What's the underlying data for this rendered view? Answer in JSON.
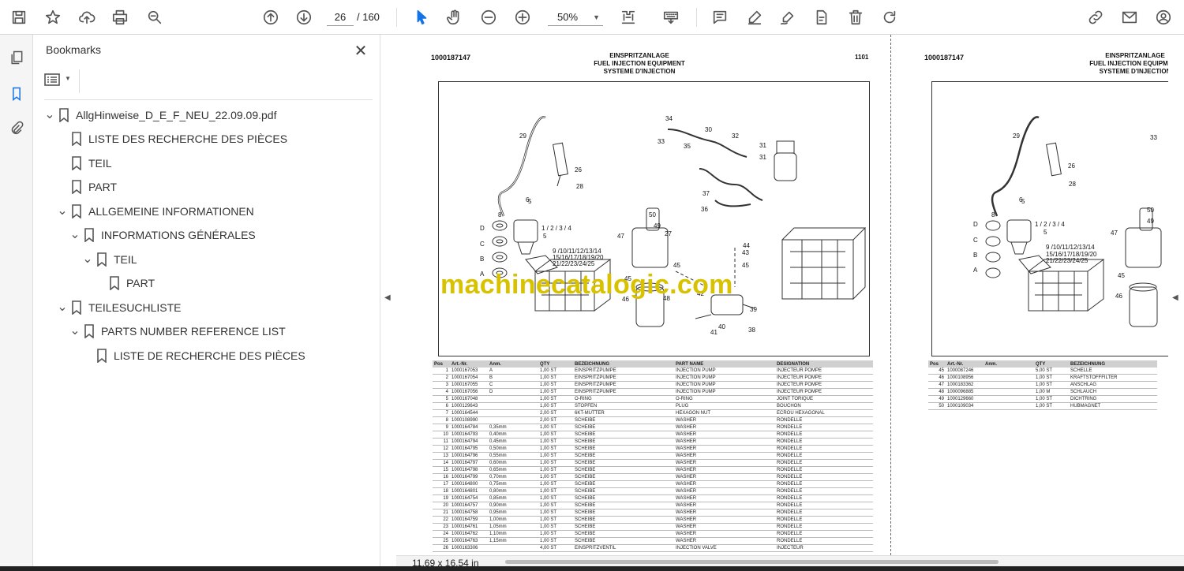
{
  "toolbar": {
    "page_current": "26",
    "page_total": "/ 160",
    "zoom": "50%",
    "icons": [
      "save-icon",
      "star-icon",
      "upload-icon",
      "print-icon",
      "zoom-search-icon",
      "page-up-icon",
      "page-down-icon",
      "select-cursor-icon",
      "hand-tool-icon",
      "zoom-out-icon",
      "zoom-in-icon",
      "fit-page-icon",
      "keyboard-icon",
      "comment-icon",
      "highlight-icon",
      "draw-icon",
      "fill-sign-icon",
      "delete-icon",
      "rotate-icon",
      "share-link-icon",
      "mail-icon",
      "account-icon"
    ]
  },
  "bookmarks_panel": {
    "title": "Bookmarks",
    "items": [
      {
        "label": "AllgHinweise_D_E_F_NEU_22.09.09.pdf",
        "level": 0,
        "expanded": true
      },
      {
        "label": "LISTE DES RECHERCHE DES PIÈCES",
        "level": 1
      },
      {
        "label": "TEIL",
        "level": 1
      },
      {
        "label": "PART",
        "level": 1
      },
      {
        "label": "ALLGEMEINE INFORMATIONEN",
        "level": 1,
        "expanded": true
      },
      {
        "label": "INFORMATIONS GÉNÉRALES",
        "level": 2,
        "expanded": true
      },
      {
        "label": "TEIL",
        "level": 3,
        "expanded": true
      },
      {
        "label": "PART",
        "level": 4
      },
      {
        "label": "TEILESUCHLISTE",
        "level": 1,
        "expanded": true
      },
      {
        "label": "PARTS NUMBER REFERENCE LIST",
        "level": 2,
        "expanded": true
      },
      {
        "label": "LISTE DE RECHERCHE DES PIÈCES",
        "level": 3
      }
    ]
  },
  "page_left": {
    "doc_number": "1000187147",
    "title_de": "EINSPRITZANLAGE",
    "title_en": "FUEL INJECTION EQUIPMENT",
    "title_fr": "SYSTEME D'INJECTION",
    "page_code": "1101",
    "callouts": [
      "29",
      "34",
      "30",
      "32",
      "31",
      "26",
      "28",
      "33",
      "35",
      "31",
      "37",
      "36",
      "5",
      "6",
      "8",
      "1 / 2 / 3 / 4",
      "5",
      "D",
      "C",
      "B",
      "A",
      "9 /10/11/12/13/14",
      "15/16/17/18/19/20",
      "21/22/23/24/25",
      "50",
      "49",
      "47",
      "27",
      "45",
      "44",
      "43",
      "45",
      "45",
      "46",
      "48",
      "42",
      "39",
      "40",
      "38",
      "41"
    ],
    "watermark": "machinecatalogic.com",
    "table_headers": [
      "Pos",
      "Art.-Nr.",
      "Anm.",
      "QTY",
      "BEZEICHNUNG",
      "PART NAME",
      "DESIGNATION"
    ],
    "rows": [
      [
        "1",
        "1000167053",
        "A",
        "1,00 ST",
        "EINSPRITZPUMPE",
        "INJECTION PUMP",
        "INJECTEUR POMPE"
      ],
      [
        "2",
        "1000167054",
        "B",
        "1,00 ST",
        "EINSPRITZPUMPE",
        "INJECTION PUMP",
        "INJECTEUR POMPE"
      ],
      [
        "3",
        "1000167055",
        "C",
        "1,00 ST",
        "EINSPRITZPUMPE",
        "INJECTION PUMP",
        "INJECTEUR POMPE"
      ],
      [
        "4",
        "1000167056",
        "D",
        "1,00 ST",
        "EINSPRITZPUMPE",
        "INJECTION PUMP",
        "INJECTEUR POMPE"
      ],
      [
        "5",
        "1000167048",
        "",
        "1,00 ST",
        "O-RING",
        "O-RING",
        "JOINT TORIQUE"
      ],
      [
        "6",
        "1000129643",
        "",
        "1,00 ST",
        "STOPFEN",
        "PLUG",
        "BOUCHON"
      ],
      [
        "7",
        "1000164544",
        "",
        "2,00 ST",
        "6KT-MUTTER",
        "HEXAGON NUT",
        "ECROU HEXAGONAL"
      ],
      [
        "8",
        "1000108990",
        "",
        "2,00 ST",
        "SCHEIBE",
        "WASHER",
        "RONDELLE"
      ],
      [
        "9",
        "1000164784",
        "0,35mm",
        "1,00 ST",
        "SCHEIBE",
        "WASHER",
        "RONDELLE"
      ],
      [
        "10",
        "1000164793",
        "0,40mm",
        "1,00 ST",
        "SCHEIBE",
        "WASHER",
        "RONDELLE"
      ],
      [
        "11",
        "1000164794",
        "0,45mm",
        "1,00 ST",
        "SCHEIBE",
        "WASHER",
        "RONDELLE"
      ],
      [
        "12",
        "1000164795",
        "0,50mm",
        "1,00 ST",
        "SCHEIBE",
        "WASHER",
        "RONDELLE"
      ],
      [
        "13",
        "1000164796",
        "0,55mm",
        "1,00 ST",
        "SCHEIBE",
        "WASHER",
        "RONDELLE"
      ],
      [
        "14",
        "1000164797",
        "0,60mm",
        "1,00 ST",
        "SCHEIBE",
        "WASHER",
        "RONDELLE"
      ],
      [
        "15",
        "1000164798",
        "0,65mm",
        "1,00 ST",
        "SCHEIBE",
        "WASHER",
        "RONDELLE"
      ],
      [
        "16",
        "1000164799",
        "0,70mm",
        "1,00 ST",
        "SCHEIBE",
        "WASHER",
        "RONDELLE"
      ],
      [
        "17",
        "1000164800",
        "0,75mm",
        "1,00 ST",
        "SCHEIBE",
        "WASHER",
        "RONDELLE"
      ],
      [
        "18",
        "1000164801",
        "0,80mm",
        "1,00 ST",
        "SCHEIBE",
        "WASHER",
        "RONDELLE"
      ],
      [
        "19",
        "1000164754",
        "0,85mm",
        "1,00 ST",
        "SCHEIBE",
        "WASHER",
        "RONDELLE"
      ],
      [
        "20",
        "1000164757",
        "0,90mm",
        "1,00 ST",
        "SCHEIBE",
        "WASHER",
        "RONDELLE"
      ],
      [
        "21",
        "1000164758",
        "0,95mm",
        "1,00 ST",
        "SCHEIBE",
        "WASHER",
        "RONDELLE"
      ],
      [
        "22",
        "1000164759",
        "1,00mm",
        "1,00 ST",
        "SCHEIBE",
        "WASHER",
        "RONDELLE"
      ],
      [
        "23",
        "1000164761",
        "1,05mm",
        "1,00 ST",
        "SCHEIBE",
        "WASHER",
        "RONDELLE"
      ],
      [
        "24",
        "1000164762",
        "1,10mm",
        "1,00 ST",
        "SCHEIBE",
        "WASHER",
        "RONDELLE"
      ],
      [
        "25",
        "1000164763",
        "1,15mm",
        "1,00 ST",
        "SCHEIBE",
        "WASHER",
        "RONDELLE"
      ],
      [
        "26",
        "1000163306",
        "",
        "4,00 ST",
        "EINSPRITZVENTIL",
        "INJECTION VALVE",
        "INJECTEUR"
      ]
    ]
  },
  "page_right": {
    "doc_number": "1000187147",
    "title_de": "EINSPRITZANLAGE",
    "title_en": "FUEL INJECTION EQUIPMENT",
    "title_fr": "SYSTEME D'INJECTION",
    "callouts": [
      "29",
      "26",
      "28",
      "5",
      "6",
      "8",
      "1 / 2 / 3 / 4",
      "5",
      "D",
      "C",
      "B",
      "A",
      "9 /10/11/12/13/14",
      "15/16/17/18/19/20",
      "21/22/23/24/25",
      "50",
      "49",
      "47",
      "45",
      "46",
      "33"
    ],
    "table_headers": [
      "Pos",
      "Art.-Nr.",
      "Anm.",
      "QTY",
      "BEZEICHNUNG"
    ],
    "rows": [
      [
        "45",
        "1000087246",
        "",
        "5,00 ST",
        "SCHELLE"
      ],
      [
        "46",
        "1000108956",
        "",
        "1,00 ST",
        "KRAFTSTOFFFILTER"
      ],
      [
        "47",
        "1000183362",
        "",
        "1,00 ST",
        "ANSCHLAG"
      ],
      [
        "48",
        "1000096885",
        "",
        "1,00 M",
        "SCHLAUCH"
      ],
      [
        "49",
        "1000129660",
        "",
        "1,00 ST",
        "DICHTRING"
      ],
      [
        "50",
        "1000109034",
        "",
        "1,00 ST",
        "HUBMAGNET"
      ]
    ]
  },
  "status": {
    "page_size": "11,69 x 16,54 in"
  }
}
